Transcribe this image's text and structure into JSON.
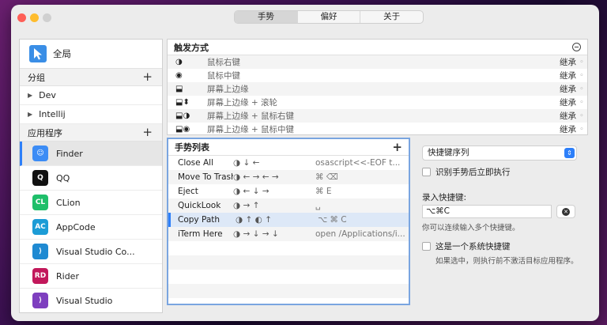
{
  "tabs": [
    {
      "label": "手势",
      "active": true
    },
    {
      "label": "偏好",
      "active": false
    },
    {
      "label": "关于",
      "active": false
    }
  ],
  "sidebar": {
    "global_label": "全局",
    "groups_header": "分组",
    "groups": [
      "Dev",
      "Intellij"
    ],
    "apps_header": "应用程序",
    "apps": [
      {
        "name": "Finder",
        "icon": "finder-icon",
        "color": "#3c8cf5",
        "glyph": "☺",
        "selected": true
      },
      {
        "name": "QQ",
        "icon": "qq-icon",
        "color": "#111111",
        "glyph": "Q",
        "selected": false
      },
      {
        "name": "CLion",
        "icon": "clion-icon",
        "color": "#1fbf6a",
        "glyph": "CL",
        "selected": false
      },
      {
        "name": "AppCode",
        "icon": "appcode-icon",
        "color": "#1c9cd6",
        "glyph": "AC",
        "selected": false
      },
      {
        "name": "Visual Studio Co...",
        "icon": "vscode-icon",
        "color": "#1f8ad2",
        "glyph": "⟩",
        "selected": false
      },
      {
        "name": "Rider",
        "icon": "rider-icon",
        "color": "#c2185b",
        "glyph": "RD",
        "selected": false
      },
      {
        "name": "Visual Studio",
        "icon": "visual-studio-icon",
        "color": "#7e3fbf",
        "glyph": "⟩",
        "selected": false
      }
    ]
  },
  "trigger": {
    "title": "触发方式",
    "rows": [
      {
        "icon": "◑",
        "name": "鼠标右键",
        "action": "继承"
      },
      {
        "icon": "◉",
        "name": "鼠标中键",
        "action": "继承"
      },
      {
        "icon": "⬓",
        "name": "屏幕上边缘",
        "action": "继承"
      },
      {
        "icon": "⬓⬍",
        "name": "屏幕上边缘 + 滚轮",
        "action": "继承"
      },
      {
        "icon": "⬓◑",
        "name": "屏幕上边缘 + 鼠标右键",
        "action": "继承"
      },
      {
        "icon": "⬓◉",
        "name": "屏幕上边缘 + 鼠标中键",
        "action": "继承"
      }
    ]
  },
  "gestures": {
    "title": "手势列表",
    "rows": [
      {
        "name": "Close All",
        "gesture": "◑ ↓ ←",
        "command": "osascript<<-EOF  t...",
        "selected": false
      },
      {
        "name": "Move To Trash",
        "gesture": "◑ ← → ← →",
        "command": "⌘ ⌫",
        "selected": false
      },
      {
        "name": "Eject",
        "gesture": "◑ ← ↓ →",
        "command": "⌘ E",
        "selected": false
      },
      {
        "name": "QuickLook",
        "gesture": "◑ → ↑",
        "command": "␣",
        "selected": false
      },
      {
        "name": "Copy Path",
        "gesture": "◑ ↑ ◐ ↑",
        "command": "⌥ ⌘ C",
        "selected": true
      },
      {
        "name": "iTerm Here",
        "gesture": "◑ → ↓ → ↓",
        "command": "open /Applications/i...",
        "selected": false
      }
    ]
  },
  "settings": {
    "action_type": "快捷键序列",
    "execute_immediately": "识别手势后立即执行",
    "record_label": "录入快捷键:",
    "shortcut_value": "⌥⌘C",
    "multi_hint": "你可以连续输入多个快捷键。",
    "system_shortcut": "这是一个系统快捷键",
    "system_hint": "如果选中，则执行前不激活目标应用程序。"
  }
}
